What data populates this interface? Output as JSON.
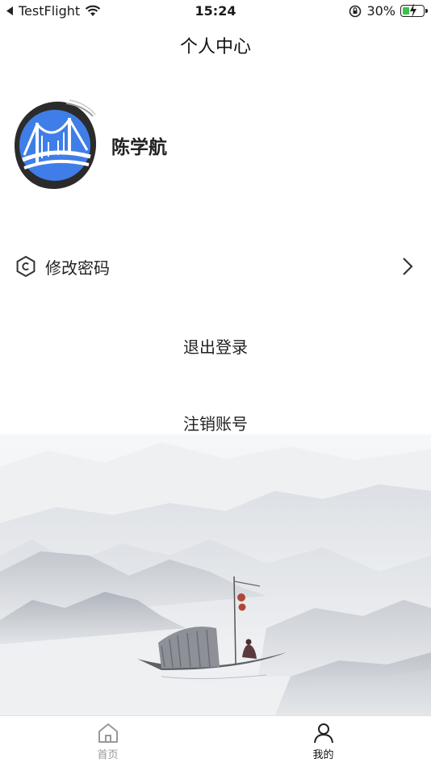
{
  "status_bar": {
    "back_app": "TestFlight",
    "time": "15:24",
    "battery": "30%"
  },
  "header": {
    "title": "个人中心"
  },
  "profile": {
    "name": "陈学航"
  },
  "menu": [
    {
      "label": "修改密码",
      "icon": "c-hexagon-icon"
    }
  ],
  "actions": {
    "logout": "退出登录",
    "delete_account": "注销账号"
  },
  "tabbar": {
    "items": [
      {
        "label": "首页",
        "icon": "home-icon",
        "active": false
      },
      {
        "label": "我的",
        "icon": "person-icon",
        "active": true
      }
    ]
  },
  "colors": {
    "avatar_blue": "#3f7ee8",
    "battery_green": "#3ac34a"
  }
}
